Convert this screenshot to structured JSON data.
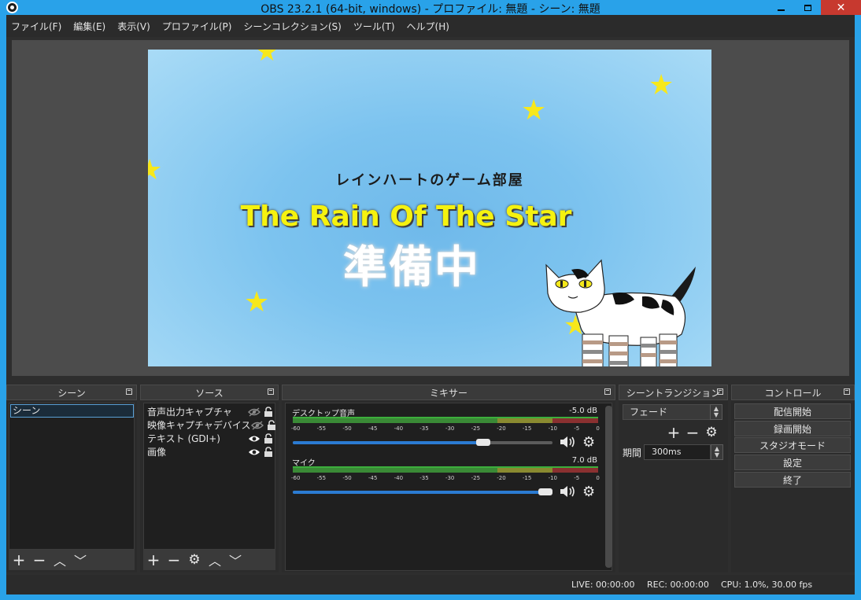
{
  "window": {
    "title": "OBS 23.2.1 (64-bit, windows) - プロファイル: 無題 - シーン: 無題"
  },
  "menu": {
    "items": [
      "ファイル(F)",
      "編集(E)",
      "表示(V)",
      "プロファイル(P)",
      "シーンコレクション(S)",
      "ツール(T)",
      "ヘルプ(H)"
    ]
  },
  "preview": {
    "subtitle": "レインハートのゲーム部屋",
    "title": "The Rain Of The Star",
    "status": "準備中"
  },
  "scenes": {
    "header": "シーン",
    "items": [
      "シーン"
    ]
  },
  "sources": {
    "header": "ソース",
    "items": [
      {
        "label": "音声出力キャプチャ",
        "visible": false
      },
      {
        "label": "映像キャプチャデバイス",
        "visible": false
      },
      {
        "label": "テキスト (GDI+)",
        "visible": true
      },
      {
        "label": "画像",
        "visible": true
      }
    ]
  },
  "mixer": {
    "header": "ミキサー",
    "ticks": [
      "-60",
      "-55",
      "-50",
      "-45",
      "-40",
      "-35",
      "-30",
      "-25",
      "-20",
      "-15",
      "-10",
      "-5",
      "0"
    ],
    "tracks": [
      {
        "name": "デスクトップ音声",
        "db": "-5.0 dB",
        "volume": 0.76
      },
      {
        "name": "マイク",
        "db": "7.0 dB",
        "volume": 1.0
      }
    ]
  },
  "transitions": {
    "header": "シーントランジション",
    "selected": "フェード",
    "duration_label": "期間",
    "duration_value": "300ms"
  },
  "controls": {
    "header": "コントロール",
    "buttons": [
      "配信開始",
      "録画開始",
      "スタジオモード",
      "設定",
      "終了"
    ]
  },
  "status": {
    "live": "LIVE: 00:00:00",
    "rec": "REC: 00:00:00",
    "cpu": "CPU: 1.0%, 30.00 fps"
  },
  "colors": {
    "titlebar": "#29a2e9",
    "accent": "#2b7bd2",
    "close": "#c7392f",
    "star": "#f7e81b"
  }
}
